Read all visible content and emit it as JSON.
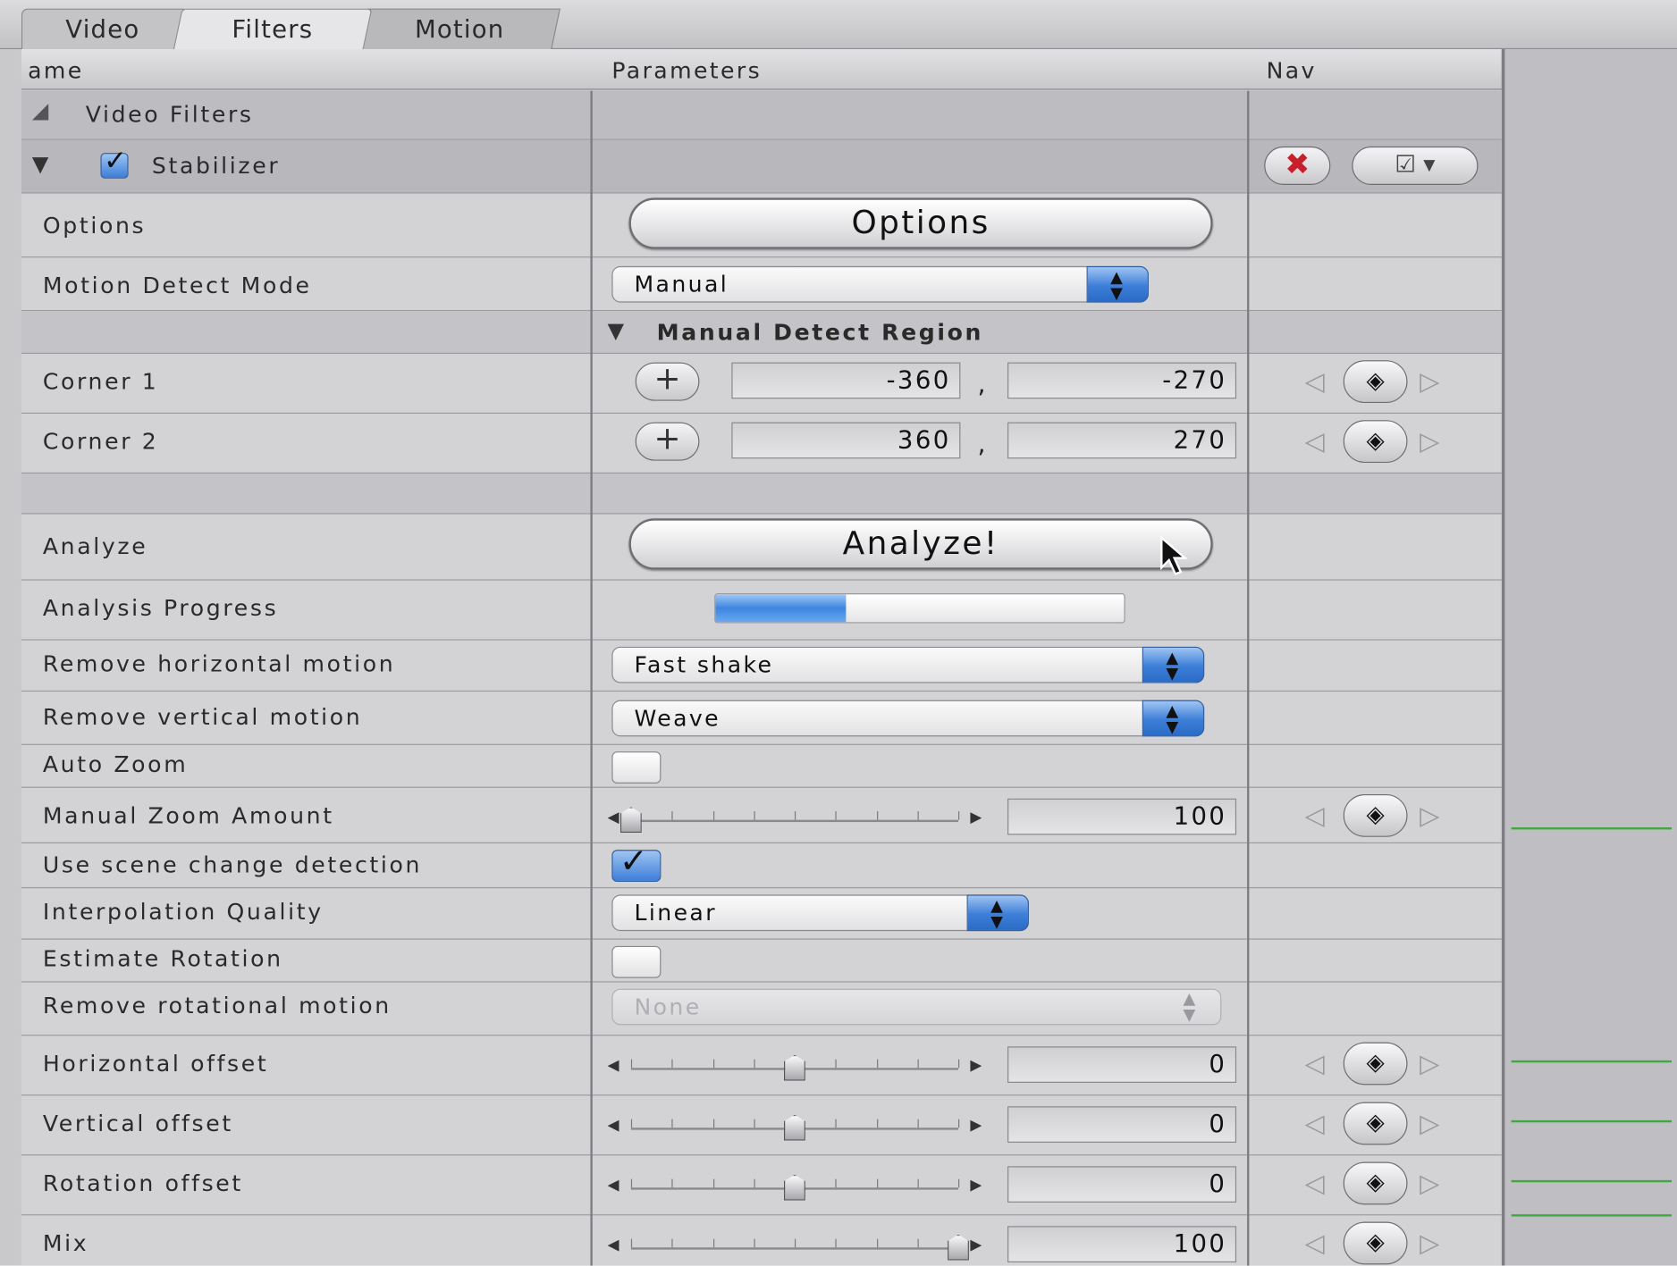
{
  "tabs": [
    "Video",
    "Filters",
    "Motion"
  ],
  "columns": {
    "name": "ame",
    "parameters": "Parameters",
    "nav": "Nav"
  },
  "group": {
    "label": "Video Filters"
  },
  "filter": {
    "label": "Stabilizer",
    "enabled": true
  },
  "options": {
    "label": "Options",
    "button": "Options"
  },
  "motion_detect_mode": {
    "label": "Motion Detect Mode",
    "value": "Manual"
  },
  "manual_detect_region": {
    "label": "Manual Detect Region"
  },
  "corner1": {
    "label": "Corner 1",
    "x": "-360",
    "y": "-270",
    "sep": ","
  },
  "corner2": {
    "label": "Corner 2",
    "x": "360",
    "y": "270",
    "sep": ","
  },
  "analyze": {
    "label": "Analyze",
    "button": "Analyze!"
  },
  "analysis_progress": {
    "label": "Analysis Progress",
    "fraction": 0.32
  },
  "remove_horizontal": {
    "label": "Remove horizontal motion",
    "value": "Fast shake"
  },
  "remove_vertical": {
    "label": "Remove vertical motion",
    "value": "Weave"
  },
  "auto_zoom": {
    "label": "Auto Zoom",
    "checked": false
  },
  "manual_zoom": {
    "label": "Manual Zoom Amount",
    "value": "100",
    "fraction": 0.0
  },
  "scene_change": {
    "label": "Use scene change detection",
    "checked": true
  },
  "interpolation": {
    "label": "Interpolation Quality",
    "value": "Linear"
  },
  "estimate_rotation": {
    "label": "Estimate Rotation",
    "checked": false
  },
  "remove_rotational": {
    "label": "Remove rotational motion",
    "value": "None",
    "disabled": true
  },
  "horizontal_offset": {
    "label": "Horizontal offset",
    "value": "0",
    "fraction": 0.5
  },
  "vertical_offset": {
    "label": "Vertical offset",
    "value": "0",
    "fraction": 0.5
  },
  "rotation_offset": {
    "label": "Rotation offset",
    "value": "0",
    "fraction": 0.5
  },
  "mix": {
    "label": "Mix",
    "value": "100",
    "fraction": 1.0
  },
  "icons": {
    "expand": "triangle-down",
    "point": "crosshair-plus",
    "keyframe": "diamond",
    "reset": "red-x",
    "menu": "checkbox-menu",
    "cursor": "arrow-pointer"
  },
  "colors": {
    "accent": "#3c7ed8",
    "reset": "#c8202a",
    "keyframe_line": "#3fa83f"
  }
}
